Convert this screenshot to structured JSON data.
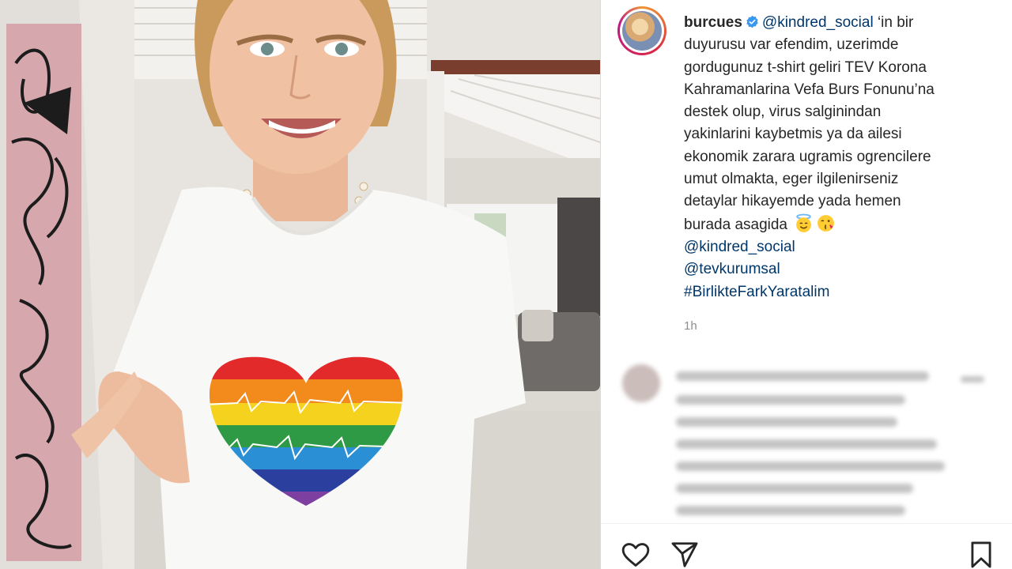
{
  "post": {
    "username": "burcues",
    "verified": true,
    "caption_lines": [
      {
        "mention": "@kindred_social",
        "text": " ‘in bir"
      },
      {
        "text": "duyurusu var efendim, uzerimde"
      },
      {
        "text": "gordugunuz t-shirt geliri TEV Korona"
      },
      {
        "text": "Kahramanlarina Vefa Burs Fonunu’na"
      },
      {
        "text": "destek olup, virus salginindan"
      },
      {
        "text": "yakinlarini kaybetmis ya da ailesi"
      },
      {
        "text": "ekonomik zarara ugramis ogrencilere"
      },
      {
        "text": "umut olmakta, eger ilgilenirseniz"
      },
      {
        "text": "detaylar hikayemde yada hemen"
      },
      {
        "text": "burada asagida"
      }
    ],
    "mentions": [
      "@kindred_social",
      "@tevkurumsal"
    ],
    "hashtag": "#BirlikteFarkYaratalim",
    "emojis": [
      "smiling-face-with-halo",
      "face-blowing-kiss"
    ],
    "time_ago": "1h"
  },
  "icons": {
    "like": "heart-icon",
    "share": "paper-plane-icon",
    "save": "bookmark-icon",
    "verified": "verified-badge-icon"
  },
  "colors": {
    "verified_blue": "#3897f0",
    "link_color": "#00376b",
    "text": "#262626",
    "meta": "#8e8e8e"
  }
}
